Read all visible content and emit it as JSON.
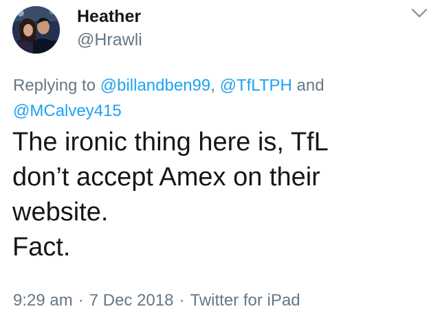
{
  "author": {
    "display_name": "Heather",
    "handle": "@Hrawli",
    "avatar_icon": "profile-photo"
  },
  "menu": {
    "icon": "chevron-down-icon"
  },
  "reply": {
    "prefix": "Replying to ",
    "mentions": [
      "@billandben99",
      "@TfLTPH",
      "@MCalvey415"
    ],
    "separator": ", ",
    "conjunction": " and "
  },
  "tweet": {
    "lines": [
      "The ironic thing here is, TfL",
      "don’t accept Amex on their",
      "website.",
      "Fact."
    ]
  },
  "meta": {
    "time": "9:29 am",
    "date": "7 Dec 2018",
    "source": "Twitter for iPad",
    "dot": "·"
  },
  "colors": {
    "text": "#14171a",
    "muted": "#657786",
    "link": "#1da1f2"
  }
}
